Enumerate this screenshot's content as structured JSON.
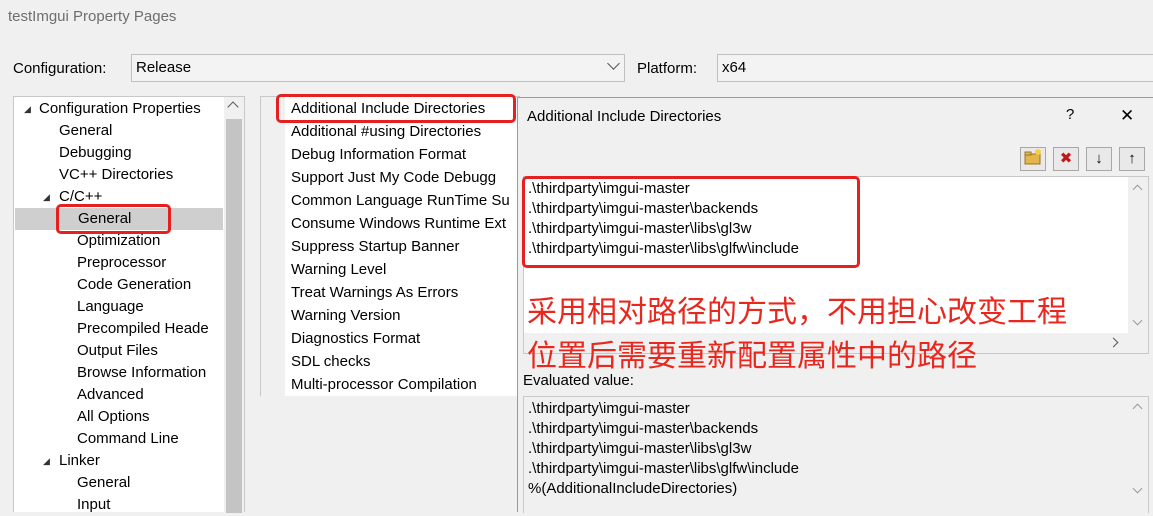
{
  "window": {
    "title": "testImgui Property Pages"
  },
  "config": {
    "configuration_label": "Configuration:",
    "configuration_value": "Release",
    "platform_label": "Platform:",
    "platform_value": "x64"
  },
  "tree": {
    "items": [
      {
        "label": "Configuration Properties"
      },
      {
        "label": "General"
      },
      {
        "label": "Debugging"
      },
      {
        "label": "VC++ Directories"
      },
      {
        "label": "C/C++"
      },
      {
        "label": "General"
      },
      {
        "label": "Optimization"
      },
      {
        "label": "Preprocessor"
      },
      {
        "label": "Code Generation"
      },
      {
        "label": "Language"
      },
      {
        "label": "Precompiled Heade"
      },
      {
        "label": "Output Files"
      },
      {
        "label": "Browse Information"
      },
      {
        "label": "Advanced"
      },
      {
        "label": "All Options"
      },
      {
        "label": "Command Line"
      },
      {
        "label": "Linker"
      },
      {
        "label": "General"
      },
      {
        "label": "Input"
      }
    ]
  },
  "properties": {
    "items": [
      {
        "label": "Additional Include Directories"
      },
      {
        "label": "Additional #using Directories"
      },
      {
        "label": "Debug Information Format"
      },
      {
        "label": "Support Just My Code Debugg"
      },
      {
        "label": "Common Language RunTime Su"
      },
      {
        "label": "Consume Windows Runtime Ext"
      },
      {
        "label": "Suppress Startup Banner"
      },
      {
        "label": "Warning Level"
      },
      {
        "label": "Treat Warnings As Errors"
      },
      {
        "label": "Warning Version"
      },
      {
        "label": "Diagnostics Format"
      },
      {
        "label": "SDL checks"
      },
      {
        "label": "Multi-processor Compilation"
      }
    ]
  },
  "dialog": {
    "title": "Additional Include Directories",
    "help": "?",
    "close": "✕",
    "toolbar": {
      "new_line": "new-folder",
      "delete": "✖",
      "move_down": "↓",
      "move_up": "↑"
    },
    "lines": [
      ".\\thirdparty\\imgui-master",
      ".\\thirdparty\\imgui-master\\backends",
      ".\\thirdparty\\imgui-master\\libs\\gl3w",
      ".\\thirdparty\\imgui-master\\libs\\glfw\\include"
    ],
    "annotation_line1": "采用相对路径的方式，不用担心改变工程",
    "annotation_line2": "位置后需要重新配置属性中的路径",
    "evaluated_label": "Evaluated value:",
    "evaluated_lines": [
      ".\\thirdparty\\imgui-master",
      ".\\thirdparty\\imgui-master\\backends",
      ".\\thirdparty\\imgui-master\\libs\\gl3w",
      ".\\thirdparty\\imgui-master\\libs\\glfw\\include",
      "%(AdditionalIncludeDirectories)"
    ]
  },
  "colors": {
    "annotation": "#e8281e",
    "highlight_box": "#e62020",
    "selected_bg": "#cfcfcf"
  }
}
